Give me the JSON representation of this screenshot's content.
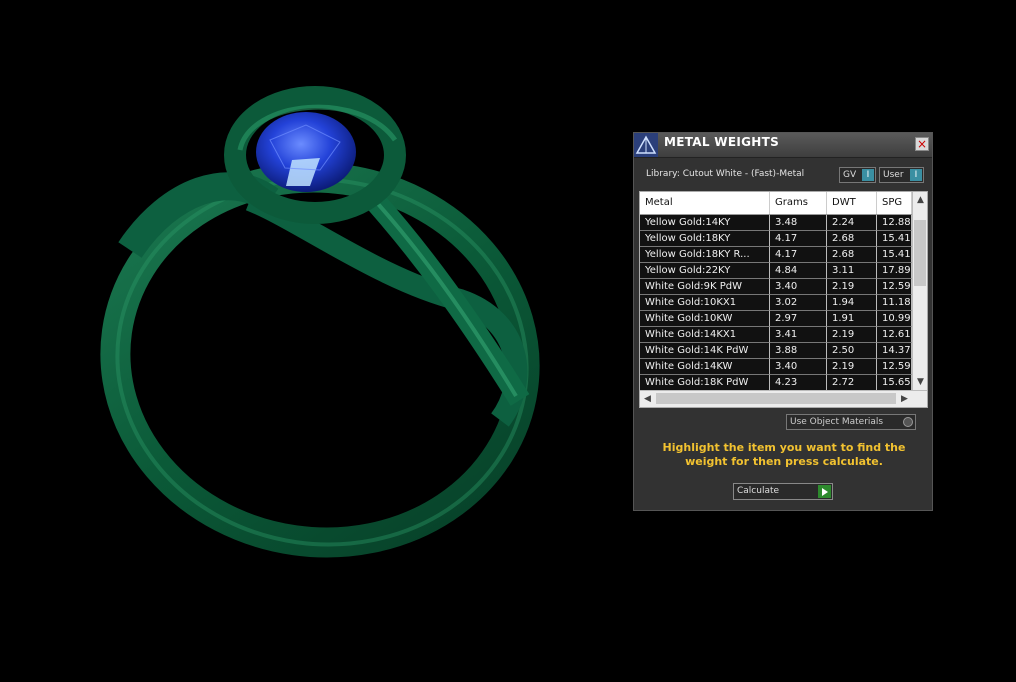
{
  "dialog": {
    "title": "METAL WEIGHTS",
    "close_label": "×",
    "library_label": "Library: Cutout White - (Fast)-Metal",
    "toggle_gv": "GV",
    "toggle_user": "User",
    "toggle_knob": "I",
    "use_object_materials": "Use Object Materials",
    "instructions": "Highlight the item you want to find the weight for then press calculate.",
    "calculate_label": "Calculate"
  },
  "table": {
    "headers": [
      "Metal",
      "Grams",
      "DWT",
      "SPG"
    ],
    "rows": [
      [
        "Yellow Gold:14KY",
        "3.48",
        "2.24",
        "12.88"
      ],
      [
        "Yellow Gold:18KY",
        "4.17",
        "2.68",
        "15.41"
      ],
      [
        "Yellow Gold:18KY R...",
        "4.17",
        "2.68",
        "15.41"
      ],
      [
        "Yellow Gold:22KY",
        "4.84",
        "3.11",
        "17.89"
      ],
      [
        "White Gold:9K PdW",
        "3.40",
        "2.19",
        "12.59"
      ],
      [
        "White Gold:10KX1",
        "3.02",
        "1.94",
        "11.18"
      ],
      [
        "White Gold:10KW",
        "2.97",
        "1.91",
        "10.99"
      ],
      [
        "White Gold:14KX1",
        "3.41",
        "2.19",
        "12.61"
      ],
      [
        "White Gold:14K PdW",
        "3.88",
        "2.50",
        "14.37"
      ],
      [
        "White Gold:14KW",
        "3.40",
        "2.19",
        "12.59"
      ],
      [
        "White Gold:18K PdW",
        "4.23",
        "2.72",
        "15.65"
      ]
    ]
  },
  "colors": {
    "ring": "#0d5a3a",
    "gem": "#1a3fd0",
    "instruction_text": "#f2c230",
    "toggle_knob": "#3a8fa2"
  }
}
